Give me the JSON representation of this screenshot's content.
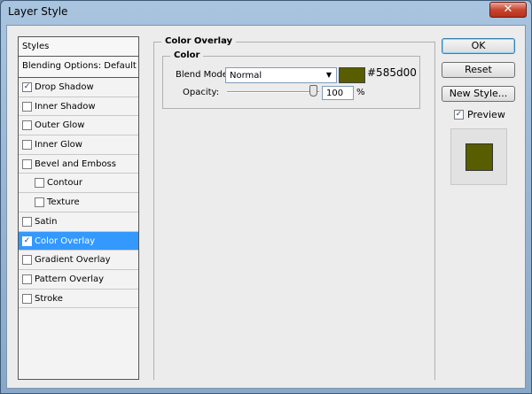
{
  "window": {
    "title": "Layer Style",
    "close_glyph": "✕"
  },
  "styles": {
    "header": "Styles",
    "blending_default": "Blending Options: Default",
    "items": [
      {
        "label": "Drop Shadow",
        "checked": true
      },
      {
        "label": "Inner Shadow",
        "checked": false
      },
      {
        "label": "Outer Glow",
        "checked": false
      },
      {
        "label": "Inner Glow",
        "checked": false
      },
      {
        "label": "Bevel and Emboss",
        "checked": false
      },
      {
        "label": "Contour",
        "checked": false,
        "sub": true
      },
      {
        "label": "Texture",
        "checked": false,
        "sub": true
      },
      {
        "label": "Satin",
        "checked": false
      },
      {
        "label": "Color Overlay",
        "checked": true,
        "selected": true
      },
      {
        "label": "Gradient Overlay",
        "checked": false
      },
      {
        "label": "Pattern Overlay",
        "checked": false
      },
      {
        "label": "Stroke",
        "checked": false
      }
    ]
  },
  "panel": {
    "section_title": "Color Overlay",
    "group_title": "Color",
    "blend_mode_label": "Blend Mode:",
    "blend_mode_value": "Normal",
    "color_hex": "#585d00",
    "opacity_label": "Opacity:",
    "opacity_value": "100",
    "opacity_unit": "%"
  },
  "buttons": {
    "ok": "OK",
    "reset": "Reset",
    "new_style": "New Style..."
  },
  "preview": {
    "label": "Preview",
    "checked": true
  },
  "colors": {
    "overlay": "#585d00",
    "selection": "#3399ff"
  }
}
